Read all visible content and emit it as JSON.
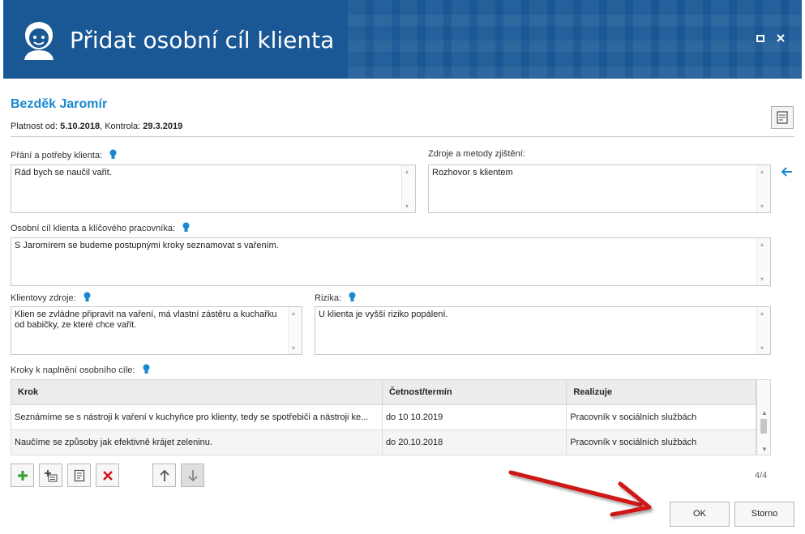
{
  "window": {
    "title": "Přidat osobní cíl klienta"
  },
  "client": {
    "name": "Bezděk Jaromír",
    "validity_label": "Platnost od:",
    "validity_from": "5.10.2018",
    "control_label": ", Kontrola:",
    "control_date": "29.3.2019"
  },
  "fields": {
    "wishes_label": "Přání a potřeby klienta:",
    "wishes_value": "Rád bych se naučil vařit.",
    "sources_label": "Zdroje a metody zjištění:",
    "sources_value": "Rozhovor s klientem",
    "goal_label": "Osobní cíl klienta a klíčového pracovníka:",
    "goal_value": "S Jaromírem se budeme postupnými kroky seznamovat s vařením.",
    "resources_label": "Klientovy zdroje:",
    "resources_value": "Klien se zvládne připravit na vaření, má vlastní zástěru a kuchařku od babičky, ze které chce vařit.",
    "risks_label": "Rizika:",
    "risks_value": "U klienta je vyšší riziko popálení.",
    "steps_label": "Kroky k naplnění osobního cíle:"
  },
  "table": {
    "headers": [
      "Krok",
      "Četnost/termín",
      "Realizuje"
    ],
    "rows": [
      [
        "Seznámíme se s nástroji k vaření v kuchyňce pro klienty, tedy se spotřebiči a nástroji ke...",
        "do 10 10.2019",
        "Pracovník v sociálních službách"
      ],
      [
        "Naučíme se způsoby jak efektivně krájet zeleninu.",
        "do 20.10.2018",
        "Pracovník v sociálních službách"
      ]
    ]
  },
  "pager": {
    "count": "4/4"
  },
  "buttons": {
    "ok": "OK",
    "cancel": "Storno"
  },
  "colors": {
    "accent": "#1a87d0",
    "titlebar": "#1a5795",
    "arrow": "#d01818"
  },
  "icons": [
    "logo-icon",
    "maximize-icon",
    "close-icon",
    "note-icon",
    "lightbulb-icon",
    "arrow-left-icon",
    "add-icon",
    "add-sub-icon",
    "edit-icon",
    "delete-icon",
    "arrow-up-icon",
    "arrow-down-icon"
  ]
}
